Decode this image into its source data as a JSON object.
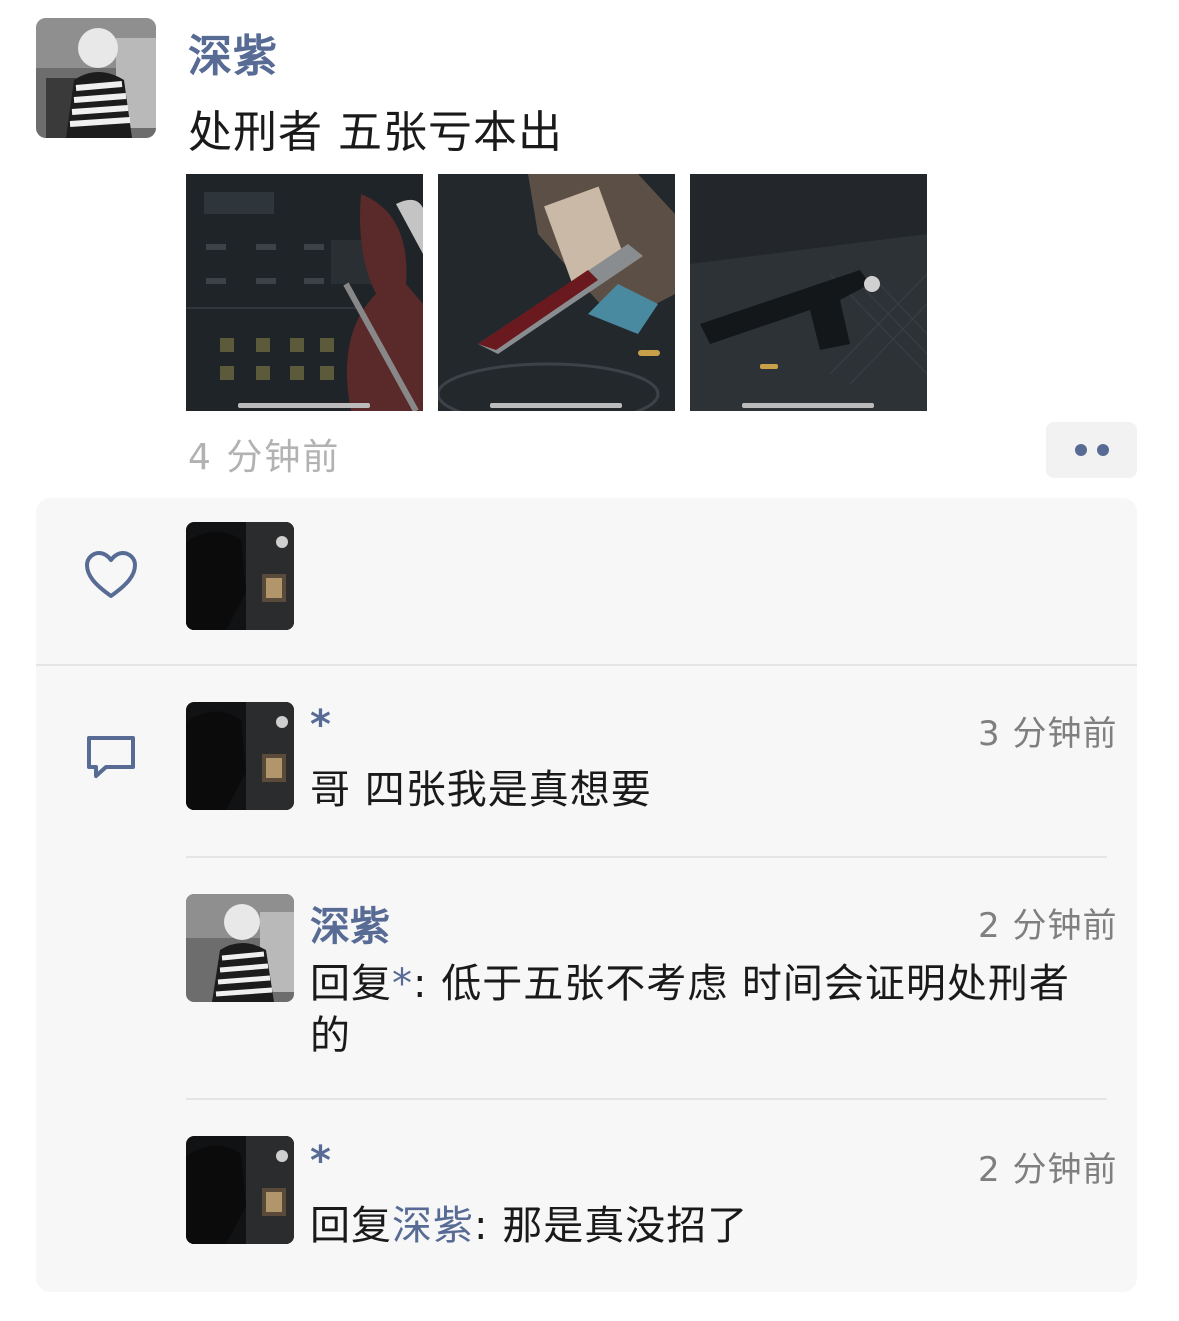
{
  "post": {
    "author": "深紫",
    "text": "处刑者 五张亏本出",
    "time": "4 分钟前",
    "thumbnails": [
      "screenshot-loadout",
      "screenshot-knife",
      "screenshot-rifle"
    ]
  },
  "likes": {
    "icon": "heart-icon",
    "users": [
      "liker"
    ]
  },
  "comments": [
    {
      "author": "*",
      "time": "3 分钟前",
      "text": "哥 四张我是真想要"
    },
    {
      "author": "深紫",
      "time": "2 分钟前",
      "reply_prefix": "回复",
      "reply_to": "*",
      "sep": ":",
      "text": "低于五张不考虑 时间会证明处刑者的"
    },
    {
      "author": "*",
      "time": "2 分钟前",
      "reply_prefix": "回复",
      "reply_to": "深紫",
      "sep": ":",
      "text": "那是真没招了"
    }
  ],
  "colors": {
    "link": "#576b95",
    "time": "#b2b2b2",
    "panel": "#f7f7f7"
  }
}
